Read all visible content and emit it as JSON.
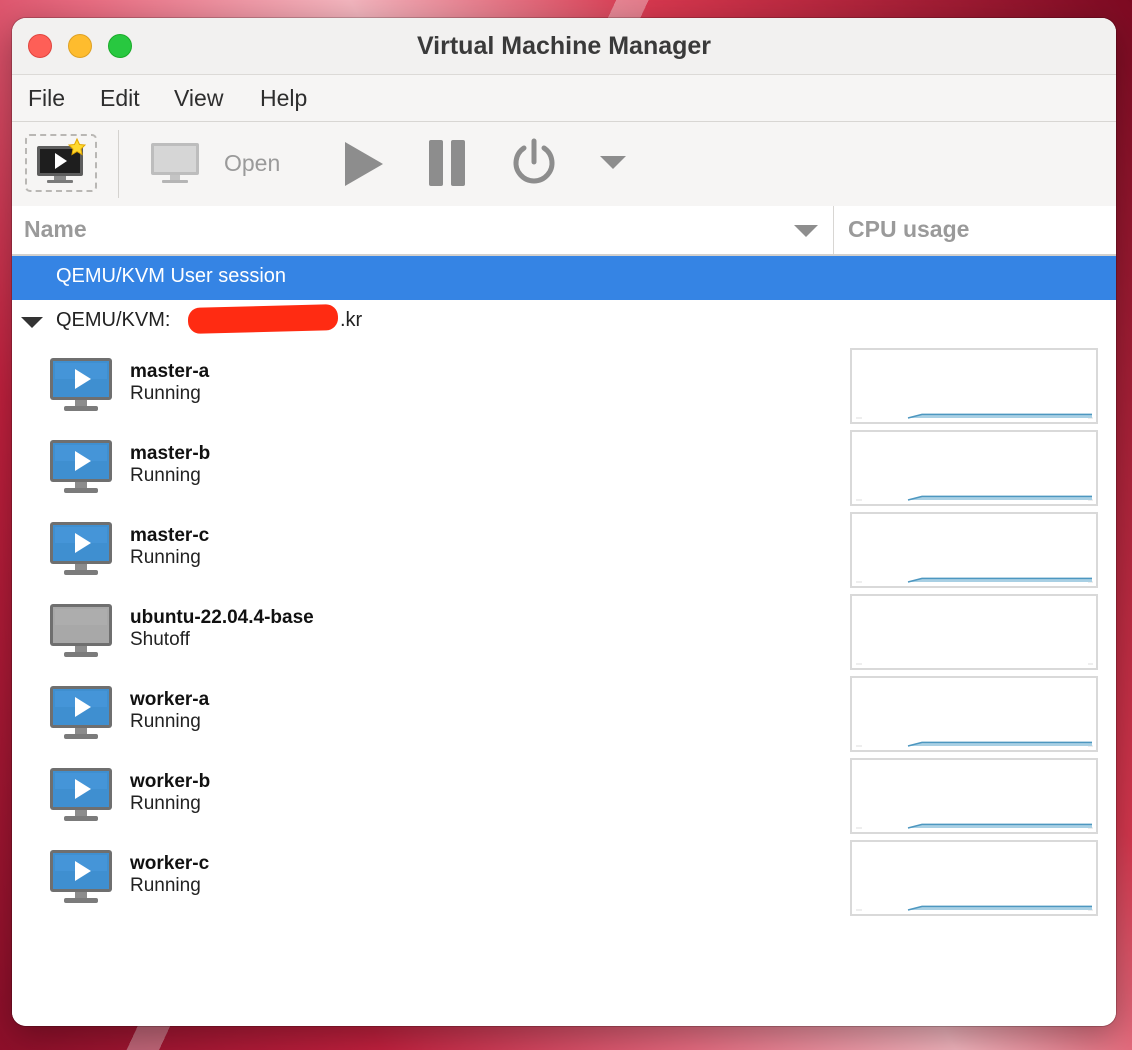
{
  "window": {
    "title": "Virtual Machine Manager"
  },
  "menu": {
    "file": "File",
    "edit": "Edit",
    "view": "View",
    "help": "Help"
  },
  "toolbar": {
    "new_vm_icon": "new-vm-icon",
    "open_label": "Open",
    "run_icon": "play-icon",
    "pause_icon": "pause-icon",
    "shutdown_icon": "power-icon",
    "shutdown_menu_icon": "chevron-down-icon"
  },
  "columns": {
    "name": "Name",
    "cpu": "CPU usage"
  },
  "connections": {
    "user_session": "QEMU/KVM User session",
    "remote_prefix": "QEMU/KVM: ",
    "remote_suffix": ".kr"
  },
  "colors": {
    "selection": "#3584e4",
    "running_icon": "#3f8fd0",
    "graph_line": "#4d97c0"
  },
  "vms": [
    {
      "name": "master-a",
      "status": "Running",
      "state": "running",
      "cpu_level": 0.05
    },
    {
      "name": "master-b",
      "status": "Running",
      "state": "running",
      "cpu_level": 0.05
    },
    {
      "name": "master-c",
      "status": "Running",
      "state": "running",
      "cpu_level": 0.05
    },
    {
      "name": "ubuntu-22.04.4-base",
      "status": "Shutoff",
      "state": "shutoff",
      "cpu_level": 0
    },
    {
      "name": "worker-a",
      "status": "Running",
      "state": "running",
      "cpu_level": 0.05
    },
    {
      "name": "worker-b",
      "status": "Running",
      "state": "running",
      "cpu_level": 0.05
    },
    {
      "name": "worker-c",
      "status": "Running",
      "state": "running",
      "cpu_level": 0.05
    }
  ]
}
